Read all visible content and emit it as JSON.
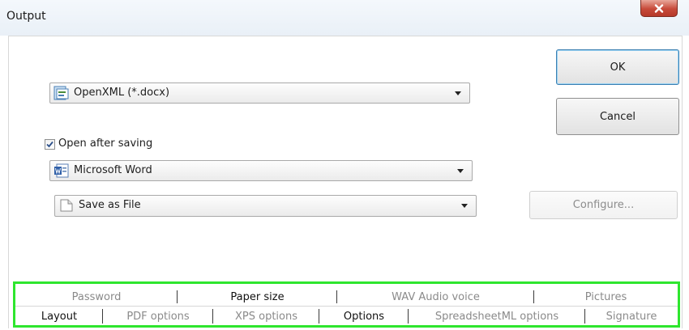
{
  "window": {
    "title": "Output"
  },
  "format_select": {
    "value": "OpenXML (*.docx)",
    "icon": "openxml-doc-icon"
  },
  "open_after_saving": {
    "label": "Open after saving",
    "checked": true
  },
  "app_select": {
    "value": "Microsoft Word",
    "icon": "word-doc-icon"
  },
  "save_select": {
    "value": "Save as File",
    "icon": "file-icon"
  },
  "buttons": {
    "ok": "OK",
    "cancel": "Cancel",
    "configure": "Configure..."
  },
  "tabs": {
    "back_row": [
      "Password",
      "Paper size",
      "WAV Audio voice",
      "Pictures"
    ],
    "front_row": [
      "Layout",
      "PDF options",
      "XPS options",
      "Options",
      "SpreadsheetML options",
      "Signature"
    ],
    "active_back": "Paper size",
    "active_front": [
      "Layout",
      "Options"
    ]
  },
  "colors": {
    "highlight_border": "#2ee62e",
    "close_button": "#c74a3a",
    "default_button_border": "#3c7fb1"
  }
}
